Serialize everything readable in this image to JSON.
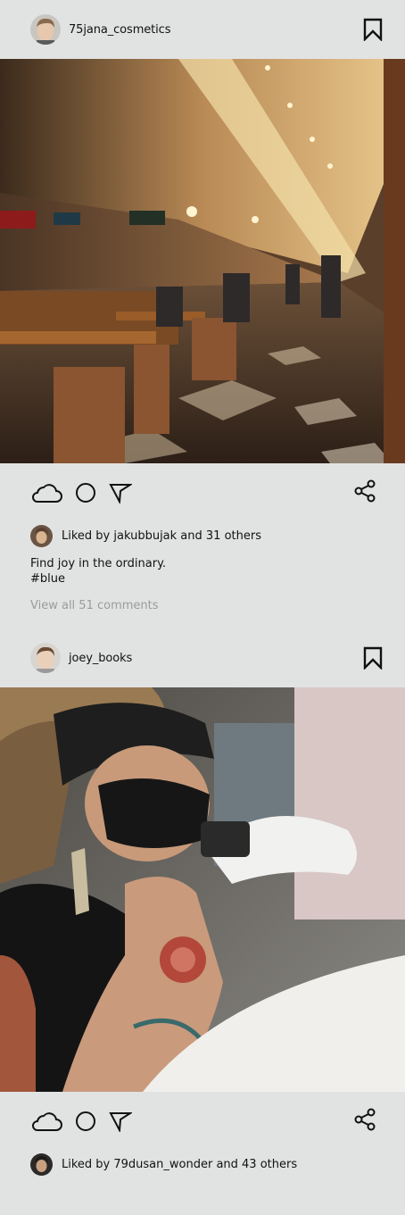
{
  "posts": [
    {
      "username": "75jana_cosmetics",
      "photo_alt": "",
      "liked_by_user": "jakubbujak",
      "liked_by_text": "Liked by jakubbujak and 31 others",
      "caption_line1": "Find joy in the ordinary.",
      "caption_line2": "#blue",
      "comments_text": "View all 51 comments"
    },
    {
      "username": "joey_books",
      "photo_alt": "",
      "liked_by_user": "79dusan_wonder",
      "liked_by_text": "Liked by 79dusan_wonder and 43 others"
    }
  ],
  "icons": {
    "like": "cloud-icon",
    "comment": "circle-icon",
    "send": "send-icon",
    "share": "share-icon",
    "save": "bookmark-icon"
  },
  "colors": {
    "background": "#e1e3e3",
    "text": "#111111",
    "muted": "#9a9c9c"
  }
}
